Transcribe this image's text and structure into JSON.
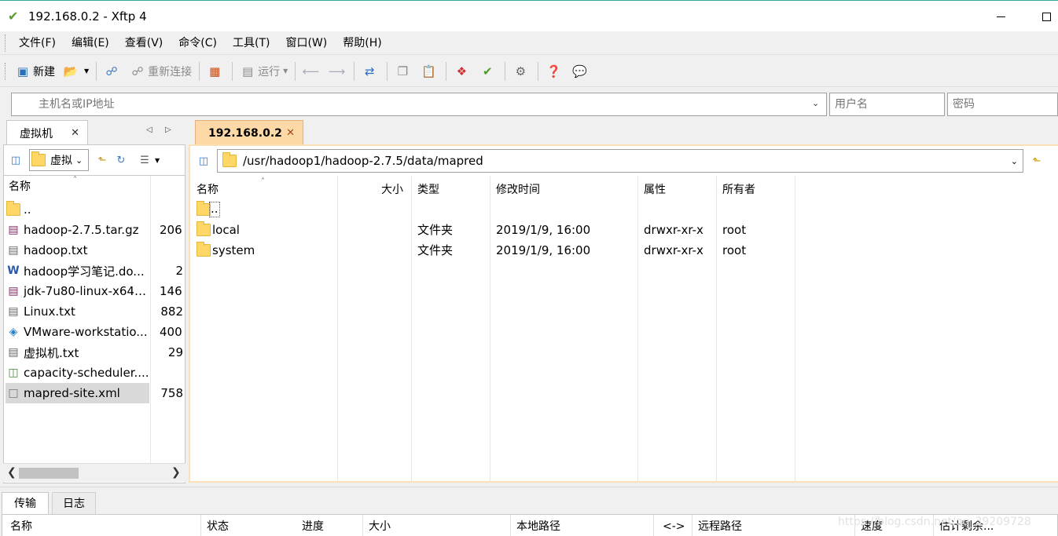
{
  "window": {
    "title": "192.168.0.2 - Xftp 4"
  },
  "menu": [
    "文件(F)",
    "编辑(E)",
    "查看(V)",
    "命令(C)",
    "工具(T)",
    "窗口(W)",
    "帮助(H)"
  ],
  "toolbar": {
    "new_label": "新建",
    "reconnect_label": "重新连接",
    "run_label": "运行"
  },
  "address": {
    "host_placeholder": "主机名或IP地址",
    "user_placeholder": "用户名",
    "password_placeholder": "密码"
  },
  "left": {
    "tab_label": "虚拟机",
    "folder_label": "虚拟",
    "columns": {
      "name": "名称"
    },
    "files": [
      {
        "name": "..",
        "size": "",
        "icon": "folder-icon"
      },
      {
        "name": "hadoop-2.7.5.tar.gz",
        "size": "206.",
        "icon": "archive-icon"
      },
      {
        "name": "hadoop.txt",
        "size": "",
        "icon": "text-file-icon"
      },
      {
        "name": "hadoop学习笔记.do...",
        "size": "2",
        "icon": "word-doc-icon"
      },
      {
        "name": "jdk-7u80-linux-x64.t...",
        "size": "146.",
        "icon": "archive-icon"
      },
      {
        "name": "Linux.txt",
        "size": "882",
        "icon": "text-file-icon"
      },
      {
        "name": "VMware-workstatio...",
        "size": "400.",
        "icon": "installer-icon"
      },
      {
        "name": "虚拟机.txt",
        "size": "29",
        "icon": "text-file-icon"
      },
      {
        "name": "capacity-scheduler....",
        "size": "",
        "icon": "xml-file-icon"
      },
      {
        "name": "mapred-site.xml",
        "size": "758",
        "icon": "blank-file-icon",
        "selected": true
      }
    ]
  },
  "right": {
    "tab_label": "192.168.0.2",
    "path": "/usr/hadoop1/hadoop-2.7.5/data/mapred",
    "columns": {
      "name": "名称",
      "size": "大小",
      "type": "类型",
      "modified": "修改时间",
      "attr": "属性",
      "owner": "所有者"
    },
    "files": [
      {
        "name": "..",
        "type": "",
        "modified": "",
        "attr": "",
        "owner": ""
      },
      {
        "name": "local",
        "type": "文件夹",
        "modified": "2019/1/9, 16:00",
        "attr": "drwxr-xr-x",
        "owner": "root"
      },
      {
        "name": "system",
        "type": "文件夹",
        "modified": "2019/1/9, 16:00",
        "attr": "drwxr-xr-x",
        "owner": "root"
      }
    ]
  },
  "bottom": {
    "tabs": [
      "传输",
      "日志"
    ],
    "columns": {
      "name": "名称",
      "status": "状态",
      "progress": "进度",
      "size": "大小",
      "local_path": "本地路径",
      "direction": "<->",
      "remote_path": "远程路径",
      "speed": "速度",
      "eta": "估计剩余..."
    },
    "watermark": "https://blog.csdn.net/qq_39209728"
  }
}
